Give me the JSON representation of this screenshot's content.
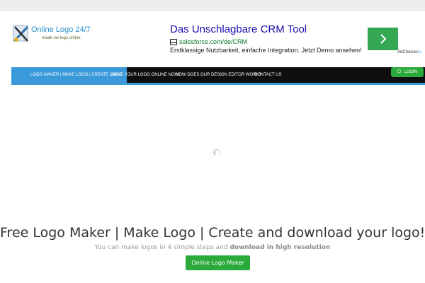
{
  "logo": {
    "name": "Online Logo 24/7",
    "tagline": "maak uw logo online"
  },
  "ad": {
    "title": "Das Unschlagbare CRM Tool",
    "url": "salesforce.com/de/CRM",
    "description": "Erstklassige Nutzbarkeit, einfache Integration. Jetzt Demo ansehen!",
    "choices_label": "AdChoices",
    "accent_color": "#34a853"
  },
  "nav": {
    "items": [
      {
        "label": "LOGO MAKER | MAKE LOGO | CREATE LOGO"
      },
      {
        "label": "MAKE YOUR LOGO ONLINE NOW!"
      },
      {
        "label": "HOW DOES OUR DESIGN EDITOR WORK?"
      },
      {
        "label": "CONTACT US"
      }
    ],
    "login_label": "LOGIN",
    "accent_color": "#3a9ad9"
  },
  "hero": {
    "title": "Free Logo Maker | Make Logo | Create and download your logo!",
    "subtitle_plain": "You can make logos in 4 simple steps and",
    "subtitle_bold": "download in high resolution",
    "button_label": "Online Logo Maker",
    "button_color": "#2aaa3a"
  },
  "icons": {
    "loading": "loading-spinner-icon",
    "login": "power-icon",
    "ad_arrow": "chevron-right-icon"
  }
}
